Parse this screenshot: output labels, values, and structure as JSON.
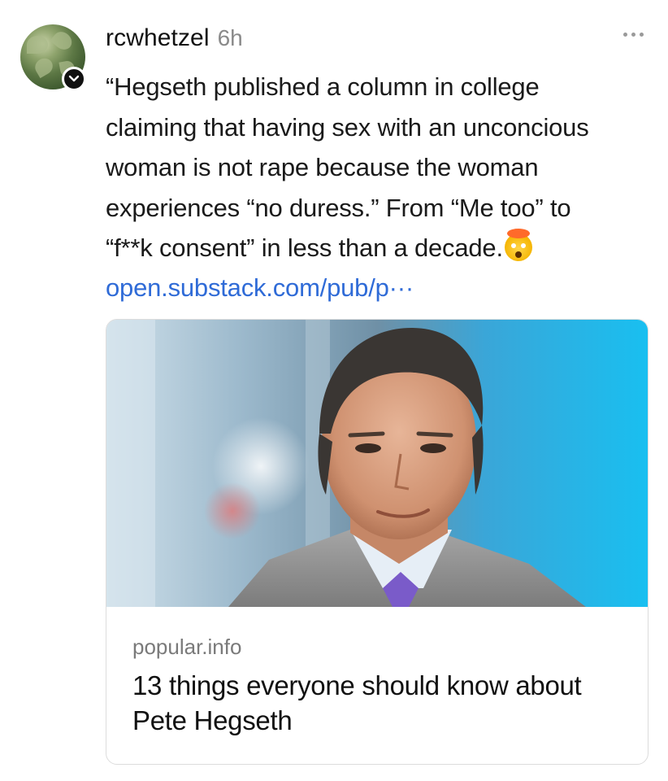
{
  "post": {
    "username": "rcwhetzel",
    "time": "6h",
    "text_lines": [
      "“Hegseth published a column in college",
      "claiming that having sex with an unconcious",
      "woman is not rape because the woman",
      "experiences “no duress.” From “Me too” to",
      "“f**k consent” in less than a decade."
    ],
    "link": "open.substack.com/pub/p···",
    "icons": {
      "avatar": "avatar-image",
      "verified": "verified-badge-icon",
      "more": "more-options-icon",
      "emoji": "exploding-head-emoji-icon"
    }
  },
  "link_card": {
    "image": "portrait-photo",
    "domain": "popular.info",
    "title": "13 things everyone should know about Pete Hegseth"
  },
  "colors": {
    "link": "#2f6bd7",
    "muted": "#8a8a8a",
    "text": "#1a1a1a"
  }
}
